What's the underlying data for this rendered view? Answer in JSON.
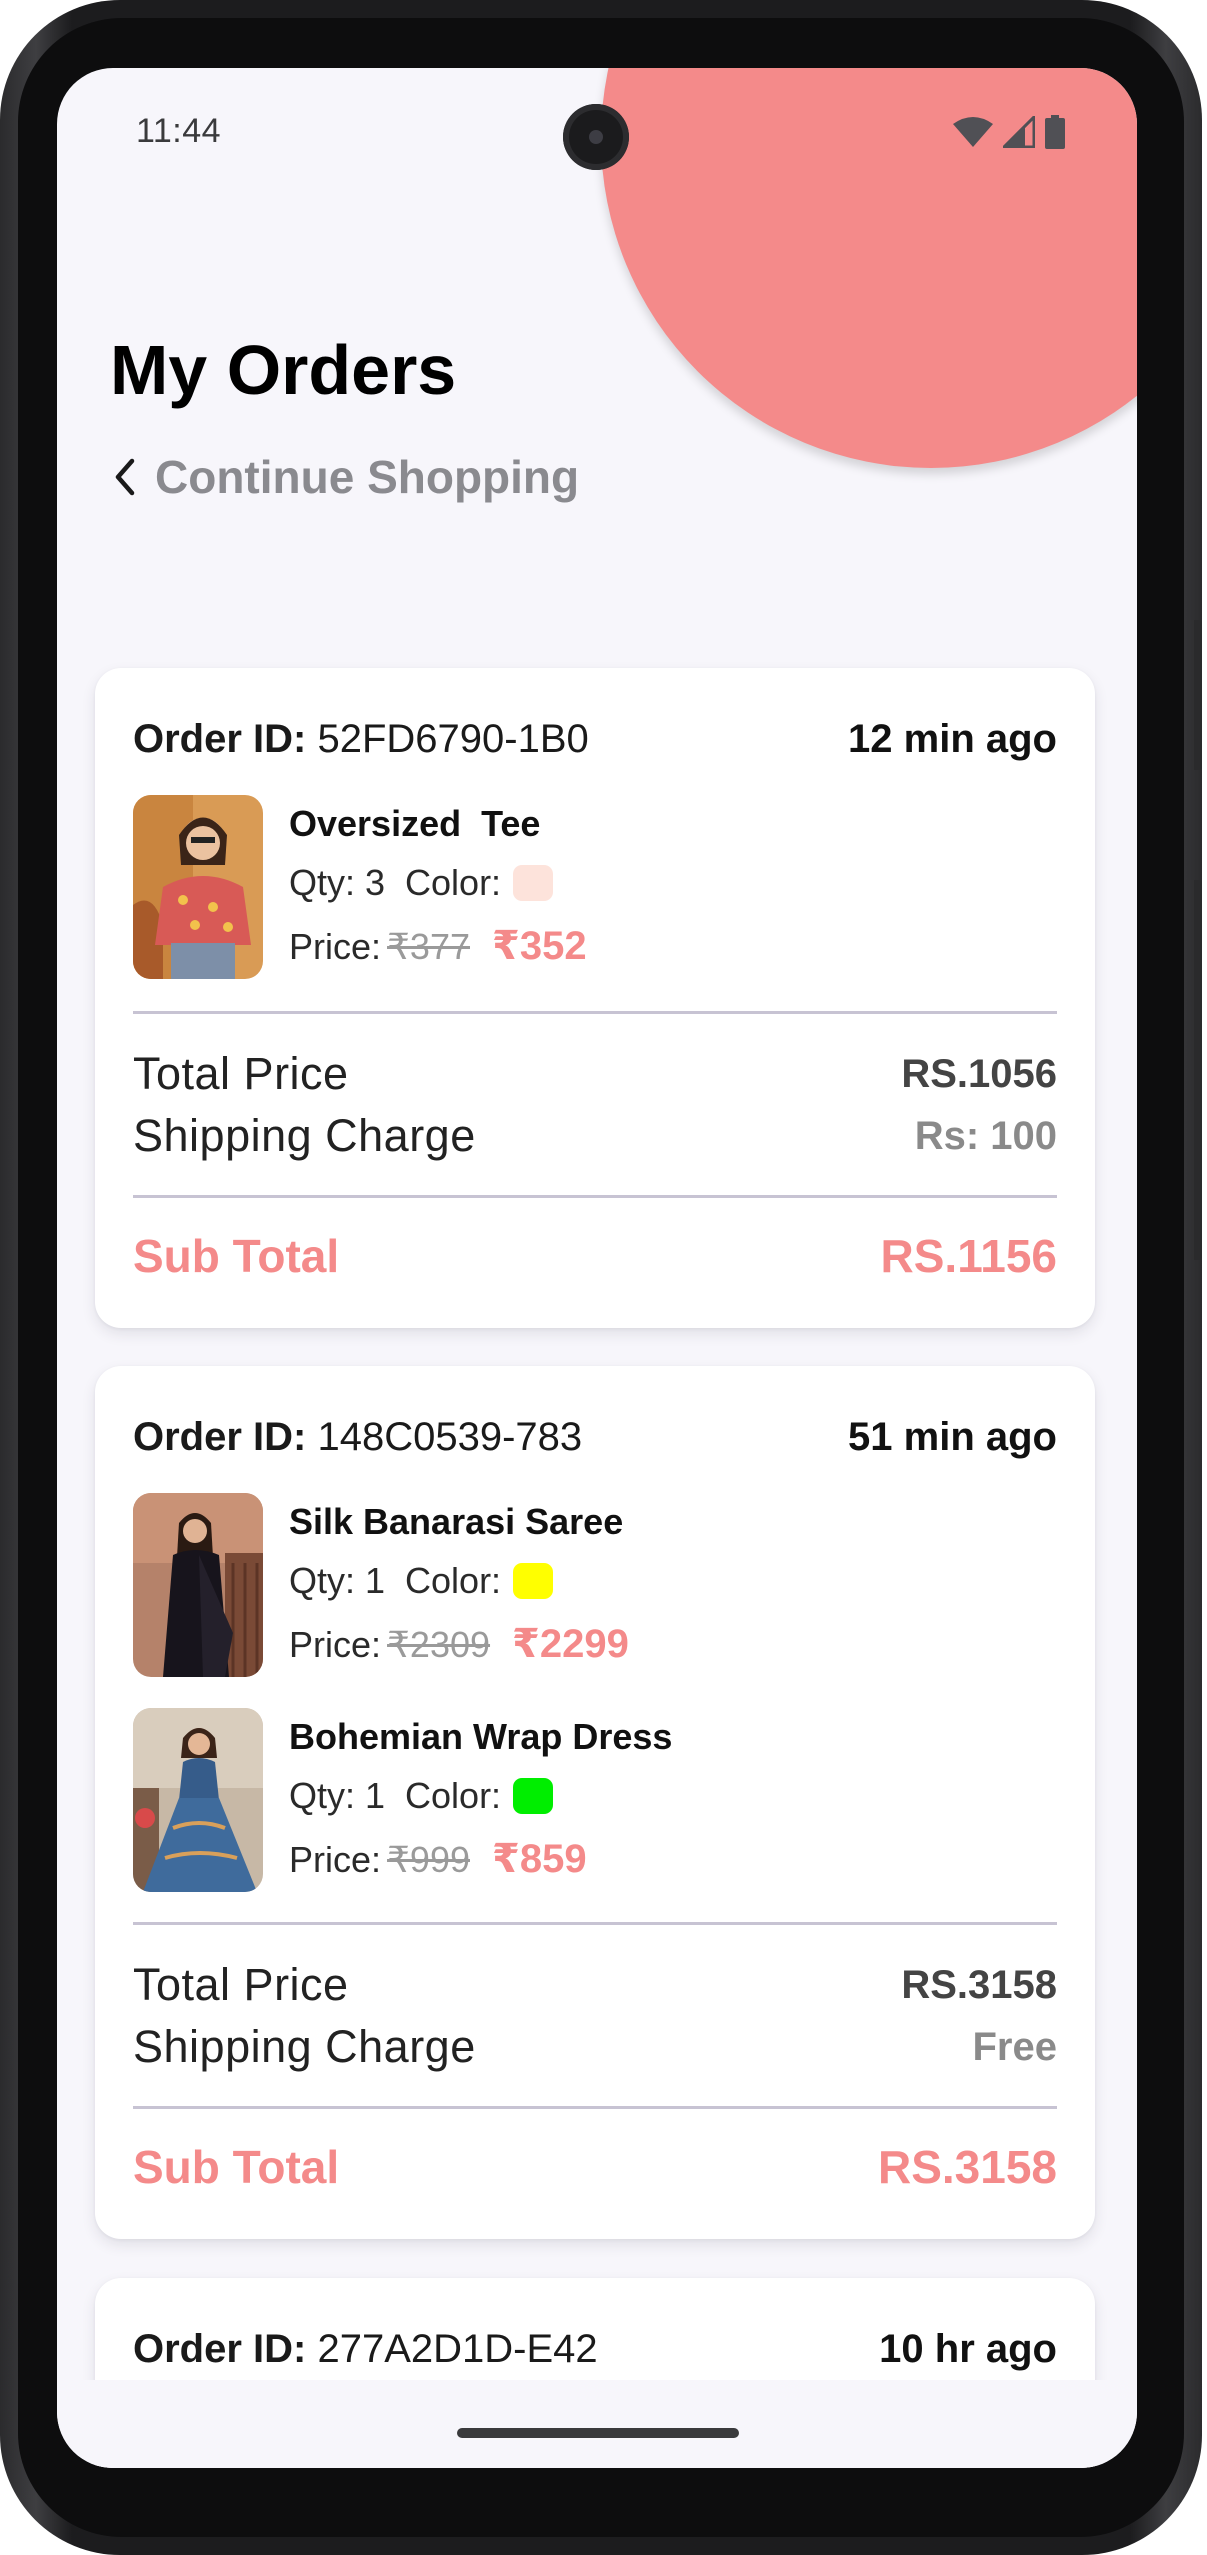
{
  "status_bar": {
    "time": "11:44"
  },
  "header": {
    "title": "My Orders",
    "back_label": "Continue Shopping"
  },
  "colors": {
    "accent": "#f48a8a",
    "background": "#f7f6fb"
  },
  "orders": [
    {
      "id_label": "Order ID:",
      "id": "52FD6790-1B0",
      "time": "12 min ago",
      "items": [
        {
          "name": "Oversized  Tee",
          "qty_label": "Qty: 3  Color:",
          "color": "#fde3db",
          "price_label": "Price:",
          "old_price": "₹377",
          "new_price": "₹352"
        }
      ],
      "total_label": "Total Price",
      "total": "RS.1056",
      "shipping_label": "Shipping Charge",
      "shipping": "Rs: 100",
      "subtotal_label": "Sub Total",
      "subtotal": "RS.1156"
    },
    {
      "id_label": "Order ID:",
      "id": "148C0539-783",
      "time": "51 min ago",
      "items": [
        {
          "name": "Silk Banarasi Saree",
          "qty_label": "Qty: 1  Color:",
          "color": "#ffff00",
          "price_label": "Price:",
          "old_price": "₹2309",
          "new_price": "₹2299"
        },
        {
          "name": "Bohemian Wrap Dress",
          "qty_label": "Qty: 1  Color:",
          "color": "#00ee00",
          "price_label": "Price:",
          "old_price": "₹999",
          "new_price": "₹859"
        }
      ],
      "total_label": "Total Price",
      "total": "RS.3158",
      "shipping_label": "Shipping Charge",
      "shipping": "Free",
      "subtotal_label": "Sub Total",
      "subtotal": "RS.3158"
    },
    {
      "id_label": "Order ID:",
      "id": "277A2D1D-E42",
      "time": "10 hr ago"
    }
  ]
}
